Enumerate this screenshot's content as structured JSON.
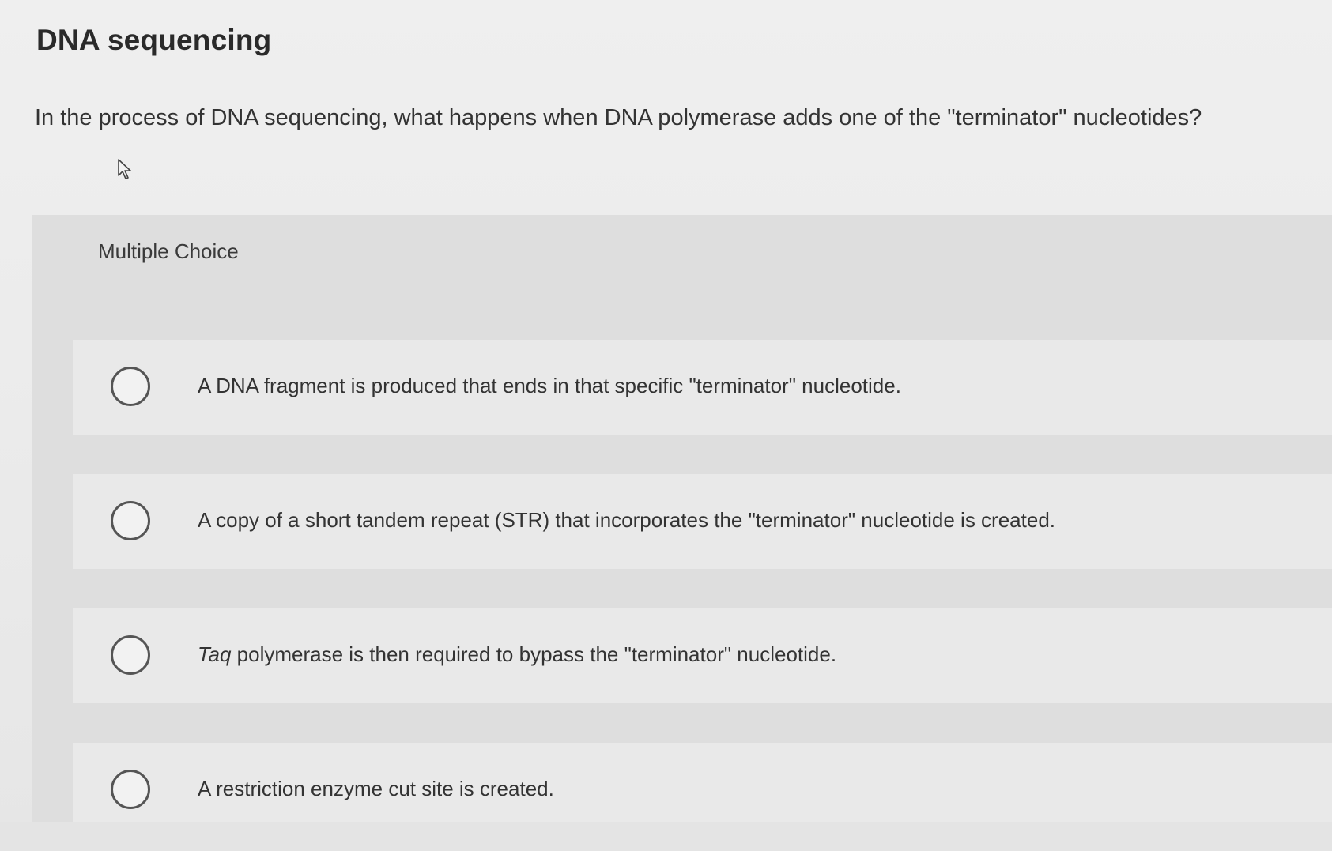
{
  "header": {
    "title": "DNA sequencing"
  },
  "question": {
    "text": "In the process of DNA sequencing, what happens when DNA polymerase adds one of the \"terminator\" nucleotides?"
  },
  "multiple_choice": {
    "label": "Multiple Choice",
    "options": [
      {
        "italic_prefix": "",
        "text": "A DNA fragment is produced that ends in that specific \"terminator\" nucleotide."
      },
      {
        "italic_prefix": "",
        "text": "A copy of a short tandem repeat (STR) that incorporates the \"terminator\" nucleotide is created."
      },
      {
        "italic_prefix": "Taq",
        "text": " polymerase is then required to bypass the \"terminator\" nucleotide."
      },
      {
        "italic_prefix": "",
        "text": "A restriction enzyme cut site is created."
      }
    ]
  },
  "icons": {
    "cursor": "mouse-pointer-icon",
    "radio": "radio-unselected-icon"
  },
  "colors": {
    "background": "#ececec",
    "panel": "#dedede",
    "option_row": "#e9e9e9",
    "text": "#333333",
    "radio_border": "#555555"
  }
}
